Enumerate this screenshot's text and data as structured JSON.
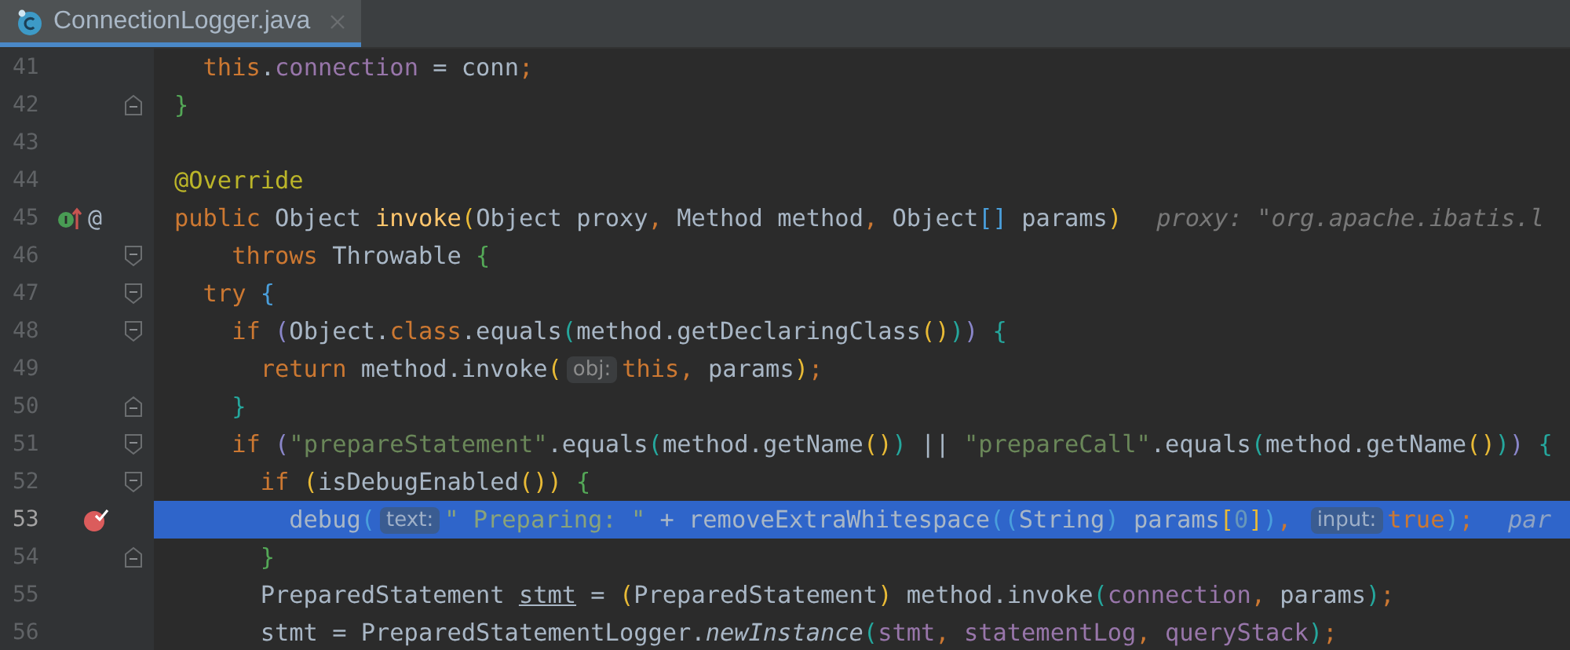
{
  "tabs": [
    {
      "label": "ConnectionLogger.java",
      "selected": true
    }
  ],
  "editor": {
    "lines": [
      {
        "number": "41",
        "selected": false,
        "breakpoint": false,
        "segments": [
          {
            "kind": "code",
            "tokens": [
              {
                "text": "  this",
                "kind": "kw"
              },
              {
                "text": ".",
                "kind": "plain"
              },
              {
                "text": "connection",
                "kind": "field"
              },
              {
                "text": " = conn",
                "kind": "plain"
              },
              {
                "text": ";",
                "kind": "kw"
              }
            ]
          }
        ]
      },
      {
        "number": "42",
        "selected": false,
        "breakpoint": false,
        "fold": {
          "kind": "end"
        },
        "segments": [
          {
            "kind": "code",
            "tokens": [
              {
                "text": "}",
                "kind": "pgreen"
              }
            ]
          }
        ]
      },
      {
        "number": "43",
        "selected": false,
        "breakpoint": false
      },
      {
        "number": "44",
        "selected": false,
        "breakpoint": false,
        "segments": [
          {
            "kind": "code",
            "tokens": [
              {
                "text": "@Override",
                "kind": "anno"
              }
            ]
          }
        ]
      },
      {
        "number": "45",
        "selected": false,
        "breakpoint": false,
        "gutter_icon": {
          "kind": "implements"
        },
        "gutter_symbol": "@",
        "segments": [
          {
            "kind": "code",
            "tokens": [
              {
                "text": "public",
                "kind": "kw"
              },
              {
                "text": " Object ",
                "kind": "plain"
              },
              {
                "text": "invoke",
                "kind": "decl"
              },
              {
                "text": "(",
                "kind": "pyellow"
              },
              {
                "text": "Object proxy",
                "kind": "plain"
              },
              {
                "text": ", ",
                "kind": "kw"
              },
              {
                "text": "Method method",
                "kind": "plain"
              },
              {
                "text": ", ",
                "kind": "kw"
              },
              {
                "text": "Object",
                "kind": "plain"
              },
              {
                "text": "[]",
                "kind": "pblue"
              },
              {
                "text": " params",
                "kind": "plain"
              },
              {
                "text": ")",
                "kind": "pyellow"
              }
            ]
          },
          {
            "kind": "tail",
            "text": "proxy: \"org.apache.ibatis.l"
          }
        ]
      },
      {
        "number": "46",
        "selected": false,
        "breakpoint": false,
        "fold": {
          "kind": "start"
        },
        "segments": [
          {
            "kind": "code",
            "tokens": [
              {
                "text": "    throws",
                "kind": "kw"
              },
              {
                "text": " Throwable ",
                "kind": "plain"
              },
              {
                "text": "{",
                "kind": "pgreen"
              }
            ]
          }
        ]
      },
      {
        "number": "47",
        "selected": false,
        "breakpoint": false,
        "fold": {
          "kind": "start"
        },
        "segments": [
          {
            "kind": "code",
            "tokens": [
              {
                "text": "  try ",
                "kind": "kw"
              },
              {
                "text": "{",
                "kind": "pblue"
              }
            ]
          }
        ]
      },
      {
        "number": "48",
        "selected": false,
        "breakpoint": false,
        "fold": {
          "kind": "start"
        },
        "segments": [
          {
            "kind": "code",
            "tokens": [
              {
                "text": "    if ",
                "kind": "kw"
              },
              {
                "text": "(",
                "kind": "ppurple"
              },
              {
                "text": "Object.",
                "kind": "plain"
              },
              {
                "text": "class",
                "kind": "kw"
              },
              {
                "text": ".equals",
                "kind": "plain"
              },
              {
                "text": "(",
                "kind": "pteal"
              },
              {
                "text": "method.getDeclaringClass",
                "kind": "plain"
              },
              {
                "text": "()",
                "kind": "pyellow"
              },
              {
                "text": ")",
                "kind": "pteal"
              },
              {
                "text": ")",
                "kind": "ppurple"
              },
              {
                "text": " {",
                "kind": "pteal"
              }
            ]
          }
        ]
      },
      {
        "number": "49",
        "selected": false,
        "breakpoint": false,
        "segments": [
          {
            "kind": "code",
            "tokens": [
              {
                "text": "      return",
                "kind": "kw"
              },
              {
                "text": " method.invoke",
                "kind": "plain"
              },
              {
                "text": "(",
                "kind": "pyellow"
              }
            ]
          },
          {
            "kind": "hint",
            "text": "obj:"
          },
          {
            "kind": "code",
            "tokens": [
              {
                "text": "this",
                "kind": "kw"
              },
              {
                "text": ", ",
                "kind": "kw"
              },
              {
                "text": "params",
                "kind": "plain"
              },
              {
                "text": ")",
                "kind": "pyellow"
              },
              {
                "text": ";",
                "kind": "kw"
              }
            ]
          }
        ]
      },
      {
        "number": "50",
        "selected": false,
        "breakpoint": false,
        "fold": {
          "kind": "end"
        },
        "segments": [
          {
            "kind": "code",
            "tokens": [
              {
                "text": "    }",
                "kind": "pteal"
              }
            ]
          }
        ]
      },
      {
        "number": "51",
        "selected": false,
        "breakpoint": false,
        "fold": {
          "kind": "start"
        },
        "segments": [
          {
            "kind": "code",
            "tokens": [
              {
                "text": "    if ",
                "kind": "kw"
              },
              {
                "text": "(",
                "kind": "ppurple"
              },
              {
                "text": "\"prepareStatement\"",
                "kind": "str"
              },
              {
                "text": ".equals",
                "kind": "plain"
              },
              {
                "text": "(",
                "kind": "pteal"
              },
              {
                "text": "method.getName",
                "kind": "plain"
              },
              {
                "text": "()",
                "kind": "pyellow"
              },
              {
                "text": ")",
                "kind": "pteal"
              },
              {
                "text": " || ",
                "kind": "plain"
              },
              {
                "text": "\"prepareCall\"",
                "kind": "str"
              },
              {
                "text": ".equals",
                "kind": "plain"
              },
              {
                "text": "(",
                "kind": "pteal"
              },
              {
                "text": "method.getName",
                "kind": "plain"
              },
              {
                "text": "()",
                "kind": "pyellow"
              },
              {
                "text": ")",
                "kind": "pteal"
              },
              {
                "text": ")",
                "kind": "ppurple"
              },
              {
                "text": " {",
                "kind": "pteal"
              }
            ]
          }
        ]
      },
      {
        "number": "52",
        "selected": false,
        "breakpoint": false,
        "fold": {
          "kind": "start"
        },
        "segments": [
          {
            "kind": "code",
            "tokens": [
              {
                "text": "      if ",
                "kind": "kw"
              },
              {
                "text": "(",
                "kind": "pyellow"
              },
              {
                "text": "isDebugEnabled",
                "kind": "plain"
              },
              {
                "text": "())",
                "kind": "pyellow"
              },
              {
                "text": " {",
                "kind": "pgreen"
              }
            ]
          }
        ]
      },
      {
        "number": "53",
        "selected": true,
        "breakpoint": true,
        "segments": [
          {
            "kind": "code",
            "tokens": [
              {
                "text": "        debug",
                "kind": "plain"
              },
              {
                "text": "(",
                "kind": "pblue"
              }
            ]
          },
          {
            "kind": "hint",
            "text": "text:"
          },
          {
            "kind": "code",
            "tokens": [
              {
                "text": "\" Preparing: \"",
                "kind": "str"
              },
              {
                "text": " + removeExtraWhitespace",
                "kind": "plain"
              },
              {
                "text": "((",
                "kind": "pblue"
              },
              {
                "text": "String",
                "kind": "plain"
              },
              {
                "text": ")",
                "kind": "pblue"
              },
              {
                "text": " params",
                "kind": "plain"
              },
              {
                "text": "[",
                "kind": "pyellow"
              },
              {
                "text": "0",
                "kind": "num"
              },
              {
                "text": "]",
                "kind": "pyellow"
              },
              {
                "text": ")",
                "kind": "pblue"
              },
              {
                "text": ", ",
                "kind": "kw"
              }
            ]
          },
          {
            "kind": "hint",
            "text": "input:"
          },
          {
            "kind": "code",
            "tokens": [
              {
                "text": "true",
                "kind": "kw"
              },
              {
                "text": ")",
                "kind": "pblue"
              },
              {
                "text": ";",
                "kind": "kw"
              }
            ]
          },
          {
            "kind": "tail",
            "text": "par"
          }
        ]
      },
      {
        "number": "54",
        "selected": false,
        "breakpoint": false,
        "fold": {
          "kind": "end"
        },
        "segments": [
          {
            "kind": "code",
            "tokens": [
              {
                "text": "      }",
                "kind": "pgreen"
              }
            ]
          }
        ]
      },
      {
        "number": "55",
        "selected": false,
        "breakpoint": false,
        "segments": [
          {
            "kind": "code",
            "tokens": [
              {
                "text": "      PreparedStatement ",
                "kind": "plain"
              },
              {
                "text": "stmt",
                "kind": "ul"
              },
              {
                "text": " = ",
                "kind": "plain"
              },
              {
                "text": "(",
                "kind": "pyellow"
              },
              {
                "text": "PreparedStatement",
                "kind": "plain"
              },
              {
                "text": ")",
                "kind": "pyellow"
              },
              {
                "text": " method.invoke",
                "kind": "plain"
              },
              {
                "text": "(",
                "kind": "pteal"
              },
              {
                "text": "connection",
                "kind": "field"
              },
              {
                "text": ", ",
                "kind": "kw"
              },
              {
                "text": "params",
                "kind": "plain"
              },
              {
                "text": ")",
                "kind": "pteal"
              },
              {
                "text": ";",
                "kind": "kw"
              }
            ]
          }
        ]
      },
      {
        "number": "56",
        "selected": false,
        "breakpoint": false,
        "segments": [
          {
            "kind": "code",
            "tokens": [
              {
                "text": "      stmt = PreparedStatementLogger.",
                "kind": "plain"
              },
              {
                "text": "newInstance",
                "kind": "static"
              },
              {
                "text": "(",
                "kind": "pteal"
              },
              {
                "text": "stmt",
                "kind": "field"
              },
              {
                "text": ", ",
                "kind": "kw"
              },
              {
                "text": "statementLog",
                "kind": "field"
              },
              {
                "text": ", ",
                "kind": "kw"
              },
              {
                "text": "queryStack",
                "kind": "field"
              },
              {
                "text": ")",
                "kind": "pteal"
              },
              {
                "text": ";",
                "kind": "kw"
              }
            ]
          }
        ]
      }
    ]
  }
}
